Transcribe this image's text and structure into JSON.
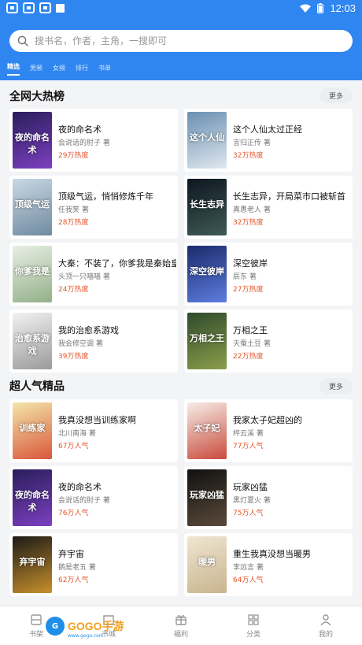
{
  "status_bar": {
    "time": "12:03"
  },
  "search": {
    "placeholder": "搜书名，作者，主角，一搜即可"
  },
  "tabs": [
    "精选",
    "男频",
    "女频",
    "排行",
    "书单"
  ],
  "sections": [
    {
      "title": "全网大热榜",
      "more_label": "更多",
      "books": [
        {
          "title": "夜的命名术",
          "author": "会说话的肘子 著",
          "stat": "29万热度",
          "cover_text": "夜的命名术",
          "cover_colors": [
            "#2a1e5c",
            "#7c3fbf"
          ]
        },
        {
          "title": "这个人仙太过正经",
          "author": "言归正传 著",
          "stat": "32万热度",
          "cover_text": "这个人仙",
          "cover_colors": [
            "#6a8fb2",
            "#dfe8ee"
          ]
        },
        {
          "title": "顶级气运，悄悄修炼千年",
          "author": "任我笑 著",
          "stat": "28万热度",
          "cover_text": "顶级气运",
          "cover_colors": [
            "#c9d8e4",
            "#6f8aa0"
          ]
        },
        {
          "title": "长生志异，开局菜市口被斩首",
          "author": "真愚老人 著",
          "stat": "32万热度",
          "cover_text": "长生志异",
          "cover_colors": [
            "#0d1620",
            "#3f5a55"
          ]
        },
        {
          "title": "大秦：不装了，你爹我是秦始皇",
          "author": "头顶一只喵喵 著",
          "stat": "24万热度",
          "cover_text": "你爹我是",
          "cover_colors": [
            "#e8efe4",
            "#93b088"
          ]
        },
        {
          "title": "深空彼岸",
          "author": "辰东 著",
          "stat": "27万热度",
          "cover_text": "深空彼岸",
          "cover_colors": [
            "#1b2a6b",
            "#5d7de0"
          ]
        },
        {
          "title": "我的治愈系游戏",
          "author": "我会修空调 著",
          "stat": "39万热度",
          "cover_text": "治愈系游戏",
          "cover_colors": [
            "#f2f2f2",
            "#9a9a9a"
          ]
        },
        {
          "title": "万相之王",
          "author": "天蚕土豆 著",
          "stat": "22万热度",
          "cover_text": "万相之王",
          "cover_colors": [
            "#2f4a2c",
            "#8a9e4a"
          ]
        }
      ]
    },
    {
      "title": "超人气精品",
      "more_label": "更多",
      "books": [
        {
          "title": "我真没想当训练家啊",
          "author": "北川南海 著",
          "stat": "67万人气",
          "cover_text": "训练家",
          "cover_colors": [
            "#f3e6a8",
            "#d9573c"
          ]
        },
        {
          "title": "我家太子妃超凶的",
          "author": "枰云溪 著",
          "stat": "77万人气",
          "cover_text": "太子妃",
          "cover_colors": [
            "#f6eee8",
            "#c94b3c"
          ]
        },
        {
          "title": "夜的命名术",
          "author": "会说话的肘子 著",
          "stat": "76万人气",
          "cover_text": "夜的命名术",
          "cover_colors": [
            "#2a1e5c",
            "#7c3fbf"
          ]
        },
        {
          "title": "玩家凶猛",
          "author": "黑灯夏火 著",
          "stat": "75万人气",
          "cover_text": "玩家凶猛",
          "cover_colors": [
            "#111111",
            "#5a4a3a"
          ]
        },
        {
          "title": "弃宇宙",
          "author": "鹅是老五 著",
          "stat": "62万人气",
          "cover_text": "弃宇宙",
          "cover_colors": [
            "#1c1a18",
            "#c8902c"
          ]
        },
        {
          "title": "重生我真没想当暖男",
          "author": "李远言 著",
          "stat": "64万人气",
          "cover_text": "暖男",
          "cover_colors": [
            "#efe6d2",
            "#c9b48e"
          ]
        }
      ]
    }
  ],
  "bottom_nav": [
    {
      "label": "书架",
      "icon": "bookshelf-icon"
    },
    {
      "label": "书城",
      "icon": "bookstore-icon"
    },
    {
      "label": "福利",
      "icon": "gift-icon"
    },
    {
      "label": "分类",
      "icon": "grid-icon"
    },
    {
      "label": "我的",
      "icon": "person-icon"
    }
  ],
  "watermark": {
    "logo": "G",
    "brand_1": "GOGO",
    "brand_2": "手游",
    "sub": "www.gogo.com"
  },
  "colors": {
    "header": "#2f86f0",
    "accent": "#e4572e",
    "background": "#f3f4f6"
  }
}
